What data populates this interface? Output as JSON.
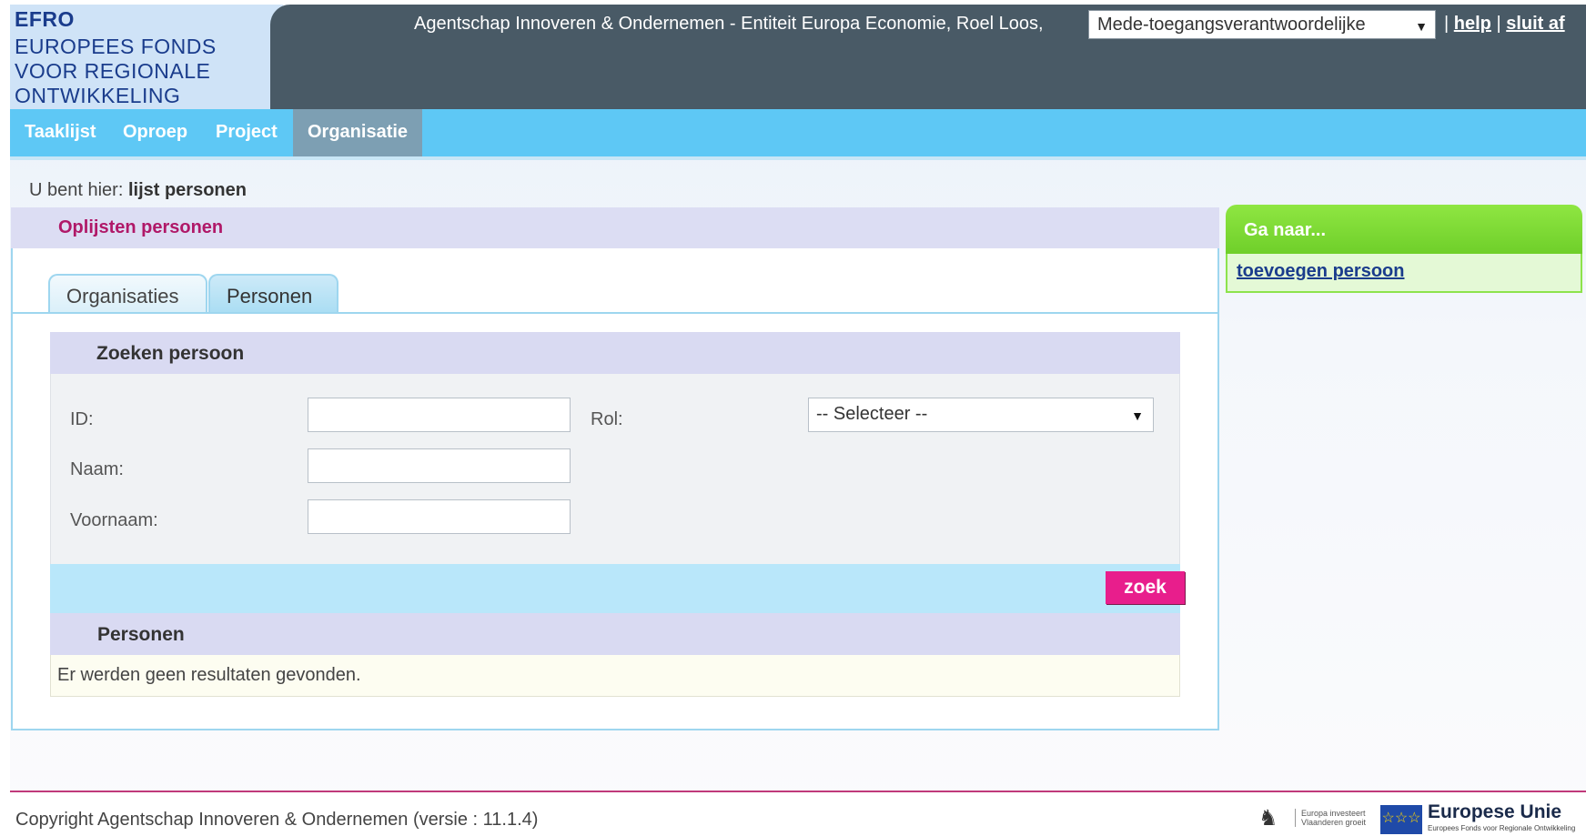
{
  "header": {
    "logo_line1": "EFRO",
    "logo_line2": "EUROPEES FONDS VOOR REGIONALE ONTWIKKELING",
    "user_info": "Agentschap Innoveren & Ondernemen - Entiteit Europa Economie,  Roel Loos,",
    "role_selected": "Mede-toegangsverantwoordelijke",
    "separator1": "|",
    "help_label": "help",
    "separator2": "|",
    "logout_label": "sluit af"
  },
  "nav": {
    "items": [
      {
        "label": "Taaklijst"
      },
      {
        "label": "Oproep"
      },
      {
        "label": "Project"
      },
      {
        "label": "Organisatie"
      }
    ]
  },
  "breadcrumb": {
    "prefix": "U bent hier:",
    "current": "lijst personen"
  },
  "main": {
    "panel_title": "Oplijsten personen",
    "tabs": [
      {
        "label": "Organisaties"
      },
      {
        "label": "Personen"
      }
    ],
    "search": {
      "title": "Zoeken persoon",
      "id_label": "ID:",
      "id_value": "",
      "naam_label": "Naam:",
      "naam_value": "",
      "voornaam_label": "Voornaam:",
      "voornaam_value": "",
      "rol_label": "Rol:",
      "rol_selected": "-- Selecteer --",
      "search_button": "zoek"
    },
    "results": {
      "title": "Personen",
      "empty_message": "Er werden geen resultaten gevonden."
    }
  },
  "sidebar": {
    "title": "Ga naar...",
    "links": [
      {
        "label": "toevoegen persoon"
      }
    ]
  },
  "footer": {
    "copyright": "Copyright Agentschap Innoveren & Ondernemen (versie : 11.1.4)",
    "vlaanderen_text_line1": "Europa investeert",
    "vlaanderen_text_line2": "Vlaanderen groeit",
    "eu_title": "Europese Unie",
    "eu_subtitle": "Europees Fonds voor Regionale Ontwikkeling"
  },
  "colors": {
    "topbar": "#495a66",
    "nav": "#5ec8f5",
    "nav_active": "#7d9fb3",
    "accent_magenta": "#e81e8c",
    "panel_title_text": "#b01868",
    "sidebar_green": "#7ad936"
  }
}
